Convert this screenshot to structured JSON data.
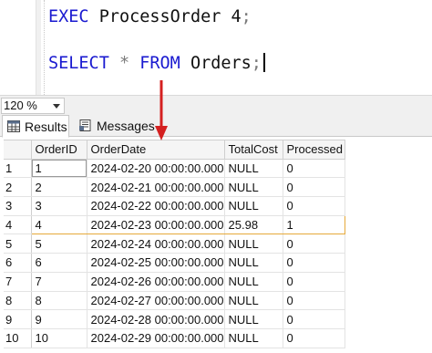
{
  "editor": {
    "line1": {
      "keyword": "EXEC",
      "proc": "ProcessOrder",
      "arg": "4",
      "end": ";"
    },
    "line2": {
      "kw1": "SELECT",
      "star": "*",
      "kw2": "FROM",
      "table": "Orders",
      "end": ";"
    }
  },
  "zoom": {
    "value": "120 %"
  },
  "tabs": {
    "results": "Results",
    "messages": "Messages"
  },
  "grid": {
    "columns": [
      "OrderID",
      "OrderDate",
      "TotalCost",
      "Processed"
    ],
    "rows": [
      {
        "n": "1",
        "id": "1",
        "date": "2024-02-20 00:00:00.000",
        "cost": "NULL",
        "processed": "0"
      },
      {
        "n": "2",
        "id": "2",
        "date": "2024-02-21 00:00:00.000",
        "cost": "NULL",
        "processed": "0"
      },
      {
        "n": "3",
        "id": "3",
        "date": "2024-02-22 00:00:00.000",
        "cost": "NULL",
        "processed": "0"
      },
      {
        "n": "4",
        "id": "4",
        "date": "2024-02-23 00:00:00.000",
        "cost": "25.98",
        "processed": "1"
      },
      {
        "n": "5",
        "id": "5",
        "date": "2024-02-24 00:00:00.000",
        "cost": "NULL",
        "processed": "0"
      },
      {
        "n": "6",
        "id": "6",
        "date": "2024-02-25 00:00:00.000",
        "cost": "NULL",
        "processed": "0"
      },
      {
        "n": "7",
        "id": "7",
        "date": "2024-02-26 00:00:00.000",
        "cost": "NULL",
        "processed": "0"
      },
      {
        "n": "8",
        "id": "8",
        "date": "2024-02-27 00:00:00.000",
        "cost": "NULL",
        "processed": "0"
      },
      {
        "n": "9",
        "id": "9",
        "date": "2024-02-28 00:00:00.000",
        "cost": "NULL",
        "processed": "0"
      },
      {
        "n": "10",
        "id": "10",
        "date": "2024-02-29 00:00:00.000",
        "cost": "NULL",
        "processed": "0"
      }
    ],
    "highlight_row": 3
  },
  "colors": {
    "keyword": "#1a1ad0",
    "highlight_border": "#e6a93a",
    "arrow": "#d42020"
  },
  "icons": {
    "results": "grid-icon",
    "messages": "messages-icon",
    "zoom": "chevron-down-icon"
  }
}
